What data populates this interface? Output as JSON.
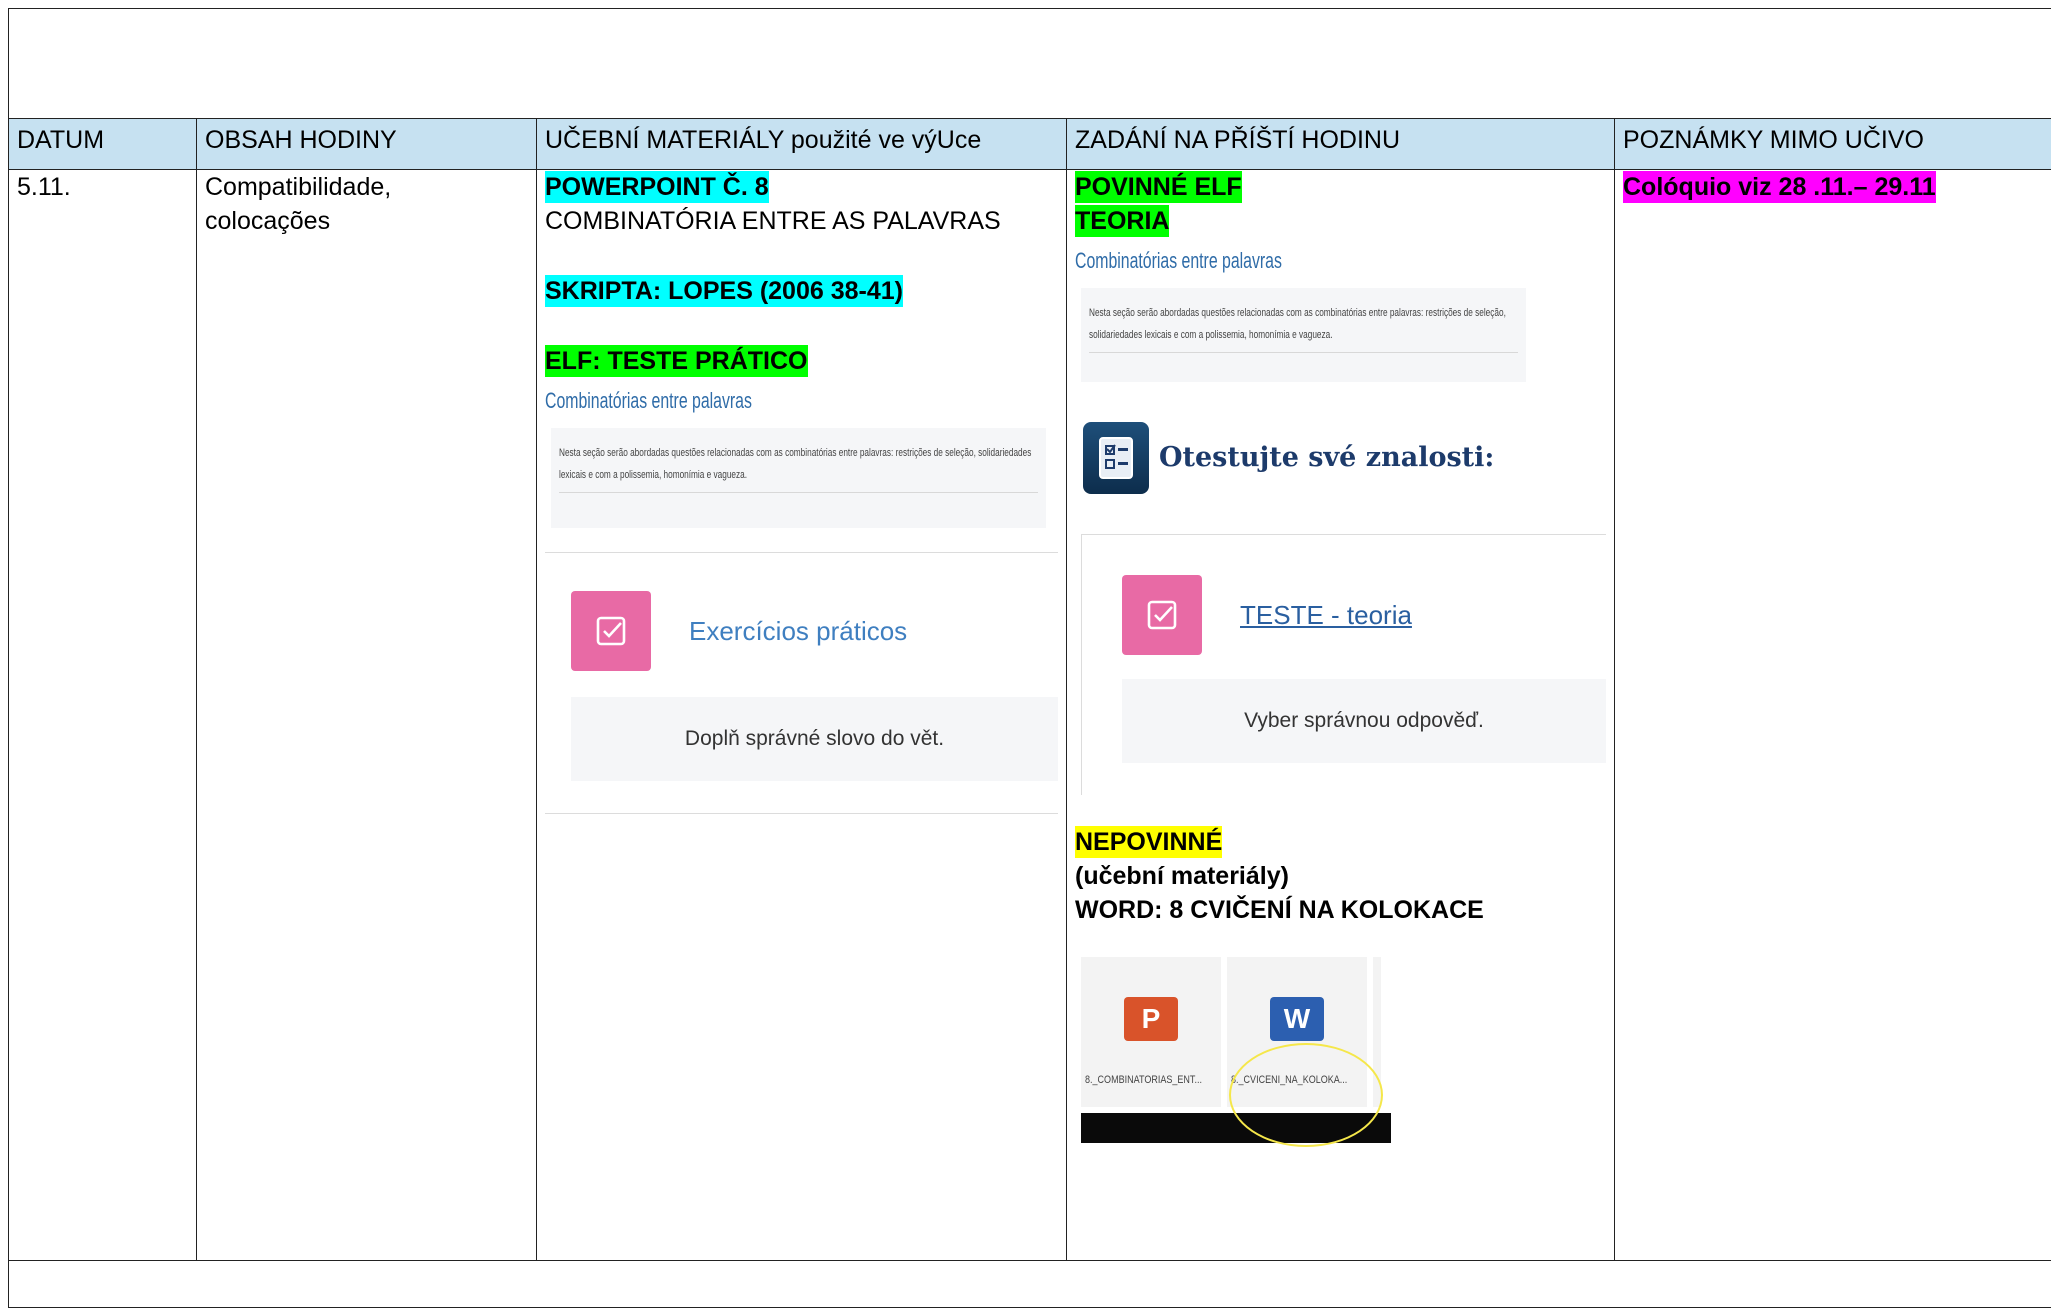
{
  "header": {
    "datum": "DATUM",
    "obsah": "OBSAH HODINY",
    "materialy": "UČEBNÍ MATERIÁLY použité ve výUce",
    "zadani": "ZADÁNÍ NA PŘÍŠTÍ HODINU",
    "poznamky": "POZNÁMKY MIMO UČIVO"
  },
  "row": {
    "datum": "5.11.",
    "obsah_line1": "Compatibilidade,",
    "obsah_line2": "colocações",
    "materialy": {
      "powerpoint": "POWERPOINT Č. 8",
      "powerpoint_sub": "COMBINATÓRIA ENTRE AS PALAVRAS",
      "skripta": "SKRIPTA: LOPES (2006 38-41)",
      "elf": "ELF: TESTE PRÁTICO",
      "link_title": "Combinatórias entre palavras",
      "preview_text": "Nesta seção serão abordadas questões relacionadas com as combinatórias entre palavras: restrições de seleção, solidariedades lexicais e com a polissemia, homonímia e vagueza.",
      "activity_title": "Exercícios práticos",
      "activity_desc": "Doplň správné slovo do vět."
    },
    "zadani": {
      "povinne": "POVINNÉ ELF",
      "teoria": "TEORIA",
      "link_title": "Combinatórias entre palavras",
      "preview_text": "Nesta seção serão abordadas questões relacionadas com as combinatórias entre palavras: restrições de seleção, solidariedades lexicais e com a polissemia, homonímia e vagueza.",
      "badge_text": "Otestujte své znalosti:",
      "activity_title": "TESTE - teoria",
      "activity_desc": "Vyber správnou odpověď.",
      "nepovinne": "NEPOVINNÉ",
      "ucebni": "(učební materiály)",
      "word": "WORD: 8 CVIČENÍ NA KOLOKACE",
      "file1_name": "8._COMBINATORIAS_ENT...",
      "file2_name": "8._CVICENI_NA_KOLOKA...",
      "file1_icon": "P",
      "file2_icon": "W"
    },
    "poznamky": "Colóquio viz 28 .11.– 29.11"
  }
}
